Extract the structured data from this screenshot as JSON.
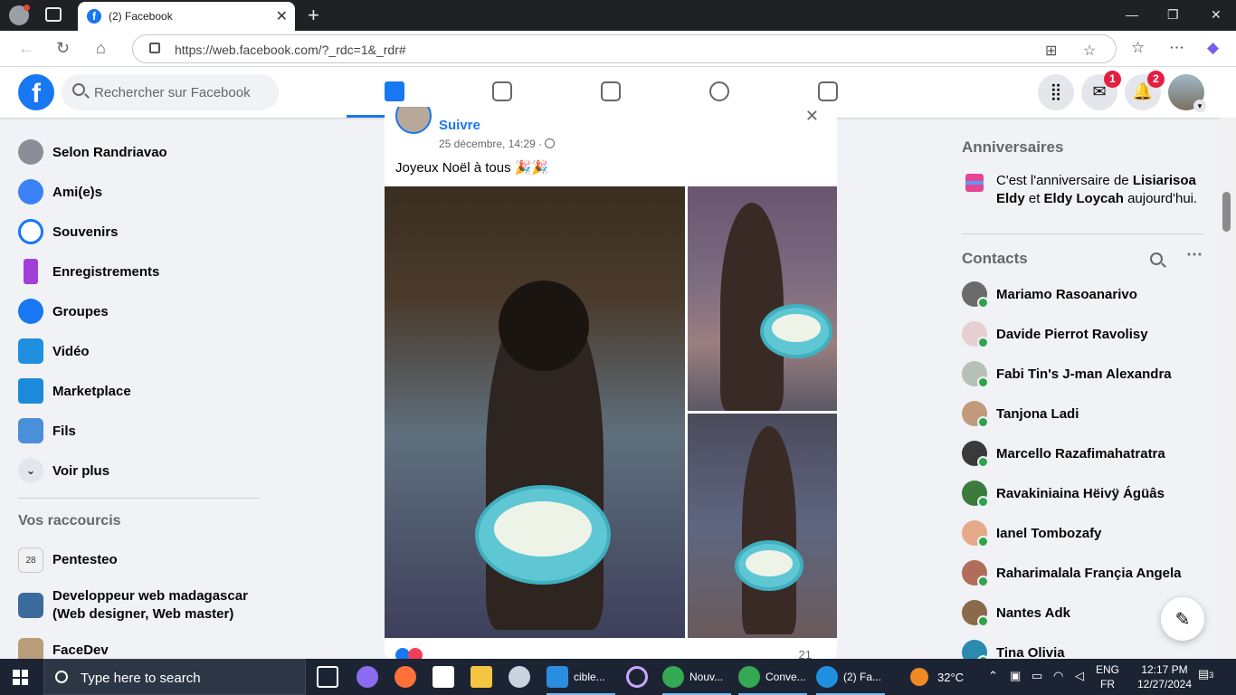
{
  "browser": {
    "tab_title": "(2) Facebook",
    "url": "https://web.facebook.com/?_rdc=1&_rdr#"
  },
  "fb": {
    "logo": "f",
    "search_placeholder": "Rechercher sur Facebook",
    "nav_tabs": [
      "home-icon",
      "video-icon",
      "marketplace-icon",
      "groups-icon",
      "gaming-icon"
    ],
    "messenger_badge": "1",
    "notifications_badge": "2"
  },
  "sidebar": {
    "items": [
      {
        "label": "Selon Randriavao",
        "icon": "profile-avatar",
        "color": "#8a8f96"
      },
      {
        "label": "Ami(e)s",
        "icon": "friends-icon",
        "color": "#3b82f6"
      },
      {
        "label": "Souvenirs",
        "icon": "memories-icon",
        "color": "#1877f2"
      },
      {
        "label": "Enregistrements",
        "icon": "bookmark-icon",
        "color": "#a33fd8"
      },
      {
        "label": "Groupes",
        "icon": "groups-icon",
        "color": "#1877f2"
      },
      {
        "label": "Vidéo",
        "icon": "video-icon",
        "color": "#1f8fe0"
      },
      {
        "label": "Marketplace",
        "icon": "marketplace-icon",
        "color": "#1b8ad8"
      },
      {
        "label": "Fils",
        "icon": "feeds-icon",
        "color": "#4a90d9"
      },
      {
        "label": "Voir plus",
        "icon": "chevron-down-icon",
        "color": "#e4e6eb"
      }
    ],
    "shortcuts_title": "Vos raccourcis",
    "shortcuts": [
      {
        "label": "Pentesteo",
        "line2": "",
        "color": "#e8e8e8"
      },
      {
        "label": "Developpeur web madagascar",
        "line2": "(Web designer, Web master)",
        "color": "#3a6b9a"
      },
      {
        "label": "FaceDev",
        "line2": "",
        "color": "#b99c78"
      }
    ]
  },
  "post": {
    "action": "Suivre",
    "date": "25 décembre, 14:29 ·",
    "text": "Joyeux Noël à tous 🎉🎉",
    "comment_count": "21"
  },
  "right": {
    "birthdays_title": "Anniversaires",
    "birthday_prefix": "C'est l'anniversaire de ",
    "birthday_name1": "Lisiarisoa Eldy",
    "birthday_mid": " et ",
    "birthday_name2": "Eldy Loycah",
    "birthday_suffix": " aujourd'hui.",
    "contacts_title": "Contacts",
    "contacts": [
      {
        "name": "Mariamo Rasoanarivo",
        "color": "#6b6b6b"
      },
      {
        "name": "Davide Pierrot Ravolisy",
        "color": "#e5cfd0"
      },
      {
        "name": "Fabi Tin's J-man Alexandra",
        "color": "#b7c0b6"
      },
      {
        "name": "Tanjona Ladi",
        "color": "#c19a7b"
      },
      {
        "name": "Marcello Razafimahatratra",
        "color": "#3a3a3a"
      },
      {
        "name": "Ravakiniaina Hëivÿ Ágüâs",
        "color": "#3c7a3e"
      },
      {
        "name": "Ianel Tombozafy",
        "color": "#e6a98a"
      },
      {
        "name": "Raharimalala Françia Angela",
        "color": "#b16d5a"
      },
      {
        "name": "Nantes Adk",
        "color": "#8a6a4a"
      },
      {
        "name": "Tina Olivia",
        "color": "#2a8ab0"
      }
    ]
  },
  "taskbar": {
    "search_placeholder": "Type here to search",
    "apps": [
      {
        "label": "cible...",
        "color": "#2b8de0"
      },
      {
        "label": "Nouv...",
        "color": "#34a853"
      },
      {
        "label": "Conve...",
        "color": "#34a853"
      },
      {
        "label": "(2) Fa...",
        "color": "#1f8fe0"
      }
    ],
    "weather": "32°C",
    "lang1": "ENG",
    "lang2": "FR",
    "time": "12:17 PM",
    "date": "12/27/2024",
    "notif_count": "3"
  }
}
